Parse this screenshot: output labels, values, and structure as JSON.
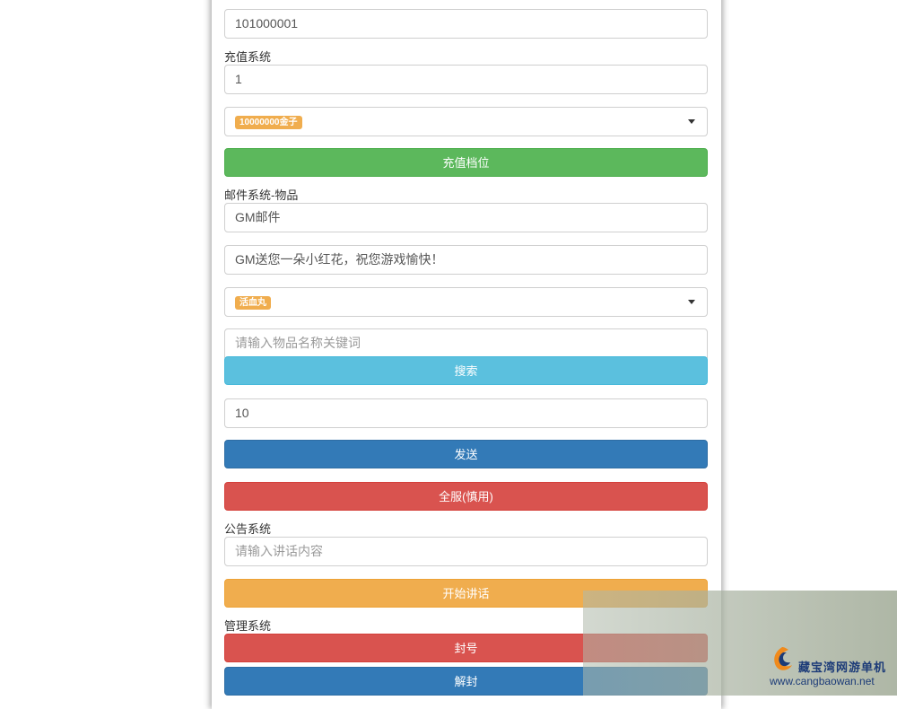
{
  "player_id": {
    "value": "101000001"
  },
  "recharge": {
    "label": "充值系统",
    "amount": "1",
    "tier_badge": "10000000金子",
    "submit_label": "充值档位"
  },
  "mail": {
    "label": "邮件系统-物品",
    "title": "GM邮件",
    "body": "GM送您一朵小红花，祝您游戏愉快！",
    "item_badge": "活血丸",
    "search_placeholder": "请输入物品名称关键词",
    "search_label": "搜索",
    "quantity": "10",
    "send_label": "发送",
    "send_all_label": "全服(慎用)"
  },
  "announcement": {
    "label": "公告系统",
    "placeholder": "请输入讲话内容",
    "start_label": "开始讲话"
  },
  "admin": {
    "label": "管理系统",
    "ban_label": "封号",
    "unban_label": "解封"
  },
  "watermark": {
    "site_name": "藏宝湾网游单机",
    "url": "www.cangbaowan.net"
  },
  "colors": {
    "green": "#5cb85c",
    "cyan": "#5bc0de",
    "blue": "#337ab7",
    "red": "#d9534f",
    "orange": "#f0ad4e"
  }
}
